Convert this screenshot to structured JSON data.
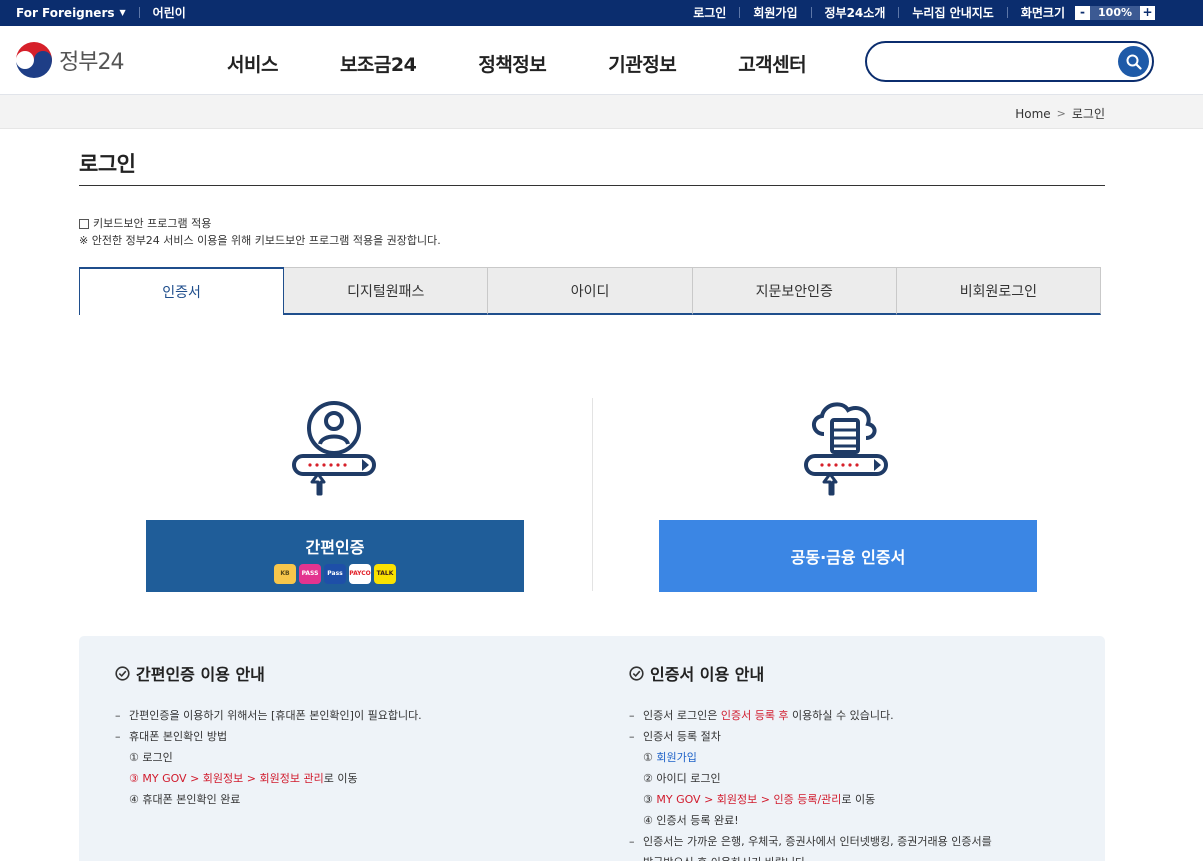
{
  "topbar": {
    "foreigners": "For Foreigners",
    "kids": "어린이",
    "links": [
      "로그인",
      "회원가입",
      "정부24소개",
      "누리집 안내지도",
      "화면크기"
    ],
    "zoom_minus": "-",
    "zoom_value": "100%",
    "zoom_plus": "+"
  },
  "header": {
    "logo_text": "정부24",
    "nav": [
      "서비스",
      "보조금24",
      "정책정보",
      "기관정보",
      "고객센터"
    ],
    "search_placeholder": ""
  },
  "breadcrumb": {
    "home": "Home",
    "current": "로그인"
  },
  "page": {
    "title": "로그인",
    "keyboard_security_label": "키보드보안 프로그램 적용",
    "keyboard_security_note": "※ 안전한 정부24 서비스 이용을 위해 키보드보안 프로그램 적용을 권장합니다."
  },
  "tabs": [
    "인증서",
    "디지털원패스",
    "아이디",
    "지문보안인증",
    "비회원로그인"
  ],
  "login": {
    "simple_auth_label": "간편인증",
    "providers": [
      "KB",
      "PASS",
      "Pass",
      "PAYCO",
      "TALK"
    ],
    "cert_label": "공동·금융 인증서"
  },
  "guide": {
    "simple": {
      "title": "간편인증 이용 안내",
      "item1": "간편인증을 이용하기 위해서는 [휴대폰 본인확인]이 필요합니다.",
      "item2": "휴대폰 본인확인 방법",
      "step1": "① 로그인",
      "step3_prefix": "③ ",
      "step3_red": "MY GOV > 회원정보 > 회원정보 관리",
      "step3_suffix": "로 이동",
      "step4": "④ 휴대폰 본인확인 완료"
    },
    "cert": {
      "title": "인증서 이용 안내",
      "item1_prefix": "인증서 로그인은 ",
      "item1_red": "인증서 등록 후",
      "item1_suffix": " 이용하실 수 있습니다.",
      "item2": "인증서 등록 절차",
      "step1_prefix": "① ",
      "step1_blue": "회원가입",
      "step2": "② 아이디 로그인",
      "step3_prefix": "③ ",
      "step3_red": "MY GOV > 회원정보 > 인증 등록/관리",
      "step3_suffix": "로 이동",
      "step4": "④ 인증서 등록 완료!",
      "item3": "인증서는 가까운 은행, 우체국, 증권사에서 인터넷뱅킹, 증권거래용 인증서를",
      "item3b": "발급받으신 후 이용하시기 바랍니다."
    }
  }
}
